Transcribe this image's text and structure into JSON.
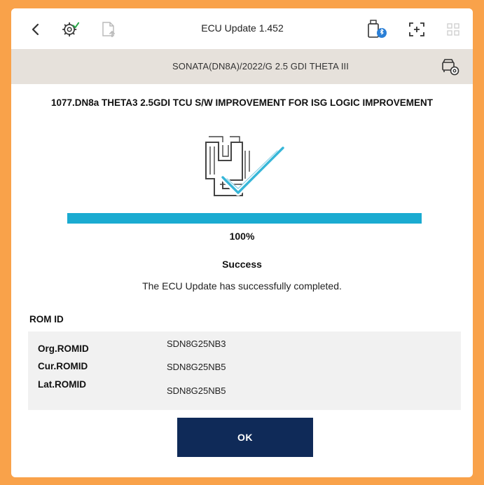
{
  "header": {
    "title": "ECU Update 1.452",
    "icons": [
      "back-icon",
      "gear-check-icon",
      "document-upload-icon",
      "vci-bluetooth-icon",
      "screen-capture-icon",
      "grid-menu-icon"
    ]
  },
  "vehicle": {
    "description": "SONATA(DN8A)/2022/G 2.5 GDI THETA III",
    "icon": "car-settings-icon"
  },
  "update": {
    "title": "1077.DN8a THETA3 2.5GDI TCU S/W IMPROVEMENT FOR ISG LOGIC IMPROVEMENT",
    "progress_percent": 100,
    "progress_text": "100%",
    "status": "Success",
    "message": "The ECU Update has successfully completed."
  },
  "rom": {
    "heading": "ROM ID",
    "rows": [
      {
        "label": "Org.ROMID",
        "value": "SDN8G25NB3"
      },
      {
        "label": "Cur.ROMID",
        "value": "SDN8G25NB5"
      },
      {
        "label": "Lat.ROMID",
        "value": "SDN8G25NB5"
      }
    ]
  },
  "actions": {
    "ok_label": "OK"
  },
  "colors": {
    "progress": "#1aabd1",
    "ok_button": "#0f2a58",
    "frame": "#f9a24a",
    "vehicle_bar": "#e6e1db"
  }
}
